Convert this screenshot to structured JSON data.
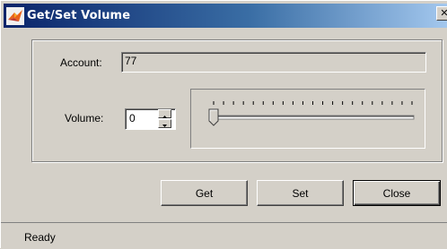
{
  "window": {
    "title": "Get/Set Volume",
    "close_glyph": "✕"
  },
  "form": {
    "account_label": "Account:",
    "account_value": "77",
    "volume_label": "Volume:",
    "volume_value": "0"
  },
  "slider": {
    "value": 0,
    "min": 0,
    "max": 20,
    "tick_count": 20
  },
  "buttons": {
    "get": "Get",
    "set": "Set",
    "close": "Close"
  },
  "status": {
    "text": "Ready"
  },
  "colors": {
    "face": "#d4d0c8",
    "title_start": "#0a246a",
    "title_end": "#a6caf0"
  }
}
